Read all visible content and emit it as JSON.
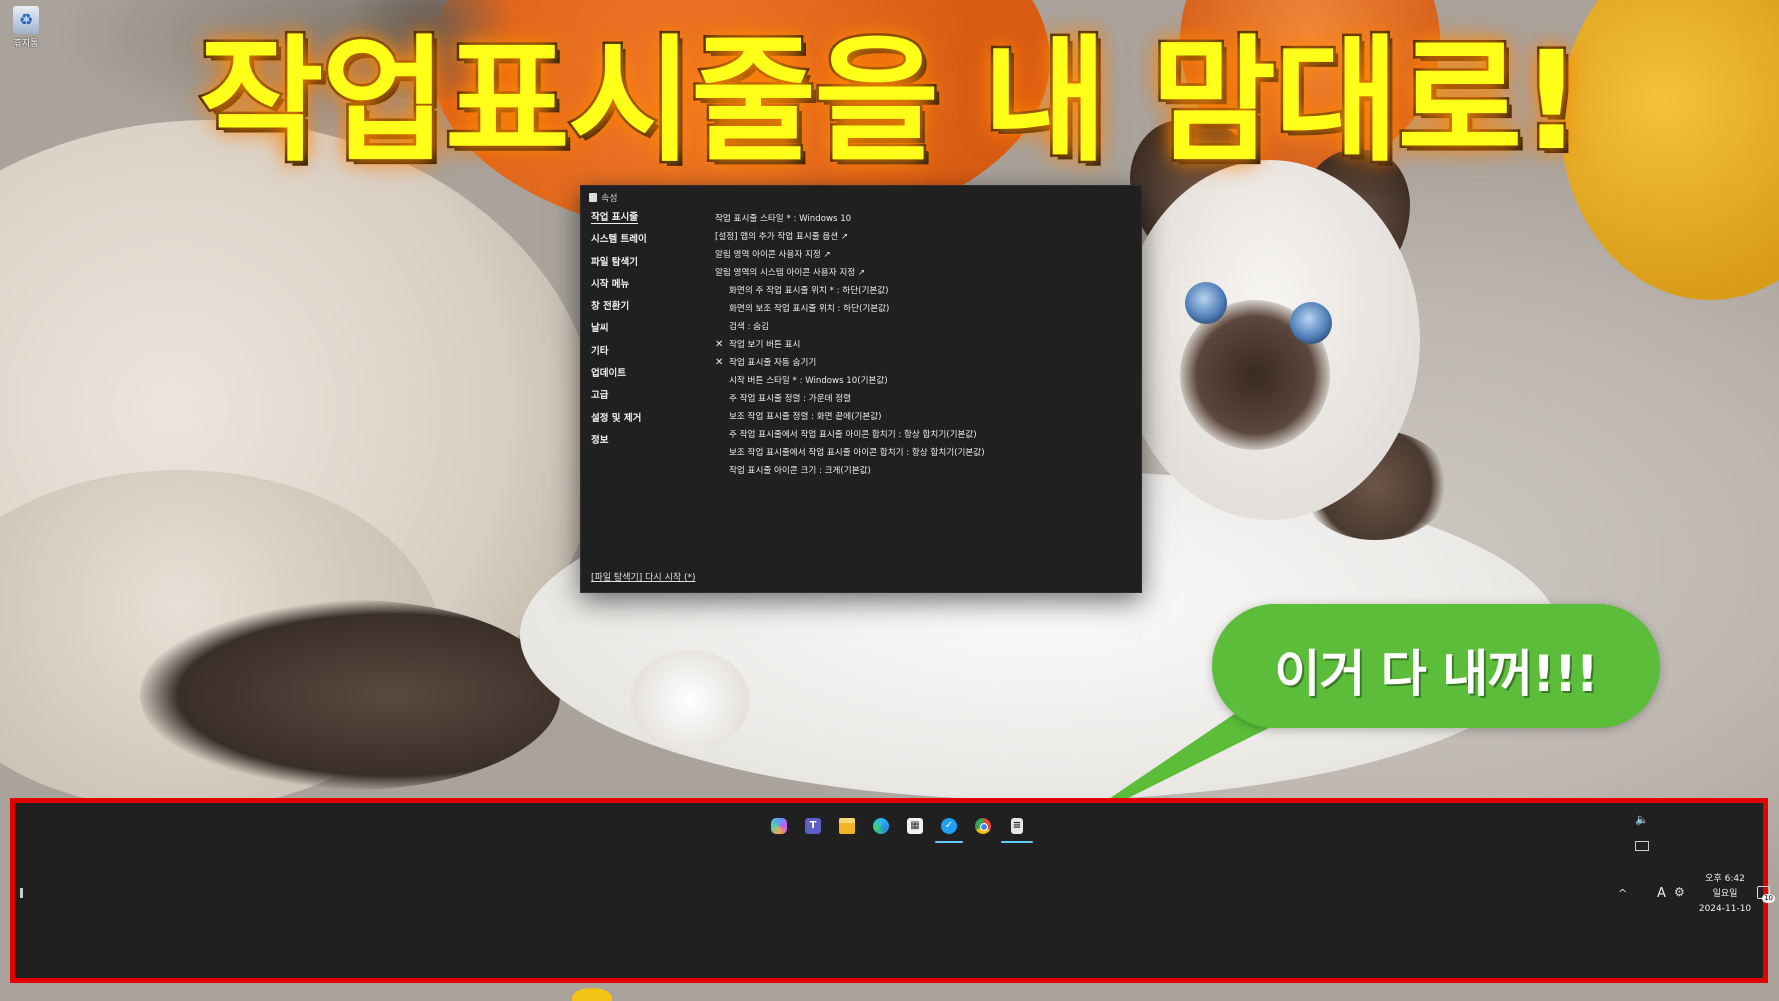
{
  "desktop": {
    "recycle_bin_label": "휴지통",
    "recycle_bin_icon": "recycle-bin-icon"
  },
  "headline": "작업표시줄을 내 맘대로!",
  "window": {
    "title": "속성",
    "nav": [
      {
        "label": "작업 표시줄",
        "active": true
      },
      {
        "label": "시스템 트레이"
      },
      {
        "label": "파일 탐색기"
      },
      {
        "label": "시작 메뉴"
      },
      {
        "label": "창 전환기"
      },
      {
        "label": "날씨"
      },
      {
        "label": "기타"
      },
      {
        "label": "업데이트"
      },
      {
        "label": "고급"
      },
      {
        "label": "설정 및 제거"
      },
      {
        "label": "정보"
      }
    ],
    "options": [
      {
        "label": "작업 표시줄 스타일 * : Windows 10",
        "indent": false,
        "checked": false
      },
      {
        "label": "[설정] 앱의 추가 작업 표시줄 옵션 ↗",
        "indent": false,
        "checked": false
      },
      {
        "label": "알림 영역 아이콘 사용자 지정 ↗",
        "indent": false,
        "checked": false
      },
      {
        "label": "알림 영역의 시스템 아이콘 사용자 지정 ↗",
        "indent": false,
        "checked": false
      },
      {
        "label": "화면의 주 작업 표시줄 위치 * : 하단(기본값)",
        "indent": true,
        "checked": false
      },
      {
        "label": "화면의 보조 작업 표시줄 위치 : 하단(기본값)",
        "indent": true,
        "checked": false
      },
      {
        "label": "검색 : 숨김",
        "indent": true,
        "checked": false
      },
      {
        "label": "작업 보기 버튼 표시",
        "indent": true,
        "checked": true
      },
      {
        "label": "작업 표시줄 자동 숨기기",
        "indent": true,
        "checked": true
      },
      {
        "label": "시작 버튼 스타일 * : Windows 10(기본값)",
        "indent": true,
        "checked": false
      },
      {
        "label": "주 작업 표시줄 정렬 : 가운데 정렬",
        "indent": true,
        "checked": false
      },
      {
        "label": "보조 작업 표시줄 정렬 : 화면 끝에(기본값)",
        "indent": true,
        "checked": false
      },
      {
        "label": "주 작업 표시줄에서 작업 표시줄 아이콘 합치기 : 항상 합치기(기본값)",
        "indent": true,
        "checked": false
      },
      {
        "label": "보조 작업 표시줄에서 작업 표시줄 아이콘 합치기 : 항상 합치기(기본값)",
        "indent": true,
        "checked": false
      },
      {
        "label": "작업 표시줄 아이콘 크기 : 크게(기본값)",
        "indent": true,
        "checked": false
      }
    ],
    "check_mark": "✕",
    "restart_link": "[파일 탐색기] 다시 시작 (*)"
  },
  "bubble": {
    "text": "이거 다 내꺼!!!",
    "color": "#5bbd3a"
  },
  "taskbar": {
    "border_color": "#e00000",
    "apps": [
      {
        "name": "copilot-icon",
        "glyph": "",
        "cls": "copilot",
        "running": false
      },
      {
        "name": "teams-icon",
        "glyph": "T",
        "cls": "teams",
        "running": false
      },
      {
        "name": "file-explorer-icon",
        "glyph": "",
        "cls": "folder",
        "running": false
      },
      {
        "name": "edge-icon",
        "glyph": "",
        "cls": "edge",
        "running": false
      },
      {
        "name": "store-icon",
        "glyph": "▦",
        "cls": "store",
        "running": false
      },
      {
        "name": "twitter-icon",
        "glyph": "✓",
        "cls": "twitter",
        "running": true
      },
      {
        "name": "chrome-icon",
        "glyph": "",
        "cls": "chrome",
        "running": false
      },
      {
        "name": "properties-app-icon",
        "glyph": "≡",
        "cls": "props",
        "running": true
      }
    ],
    "tray": {
      "volume_icon": "🔈",
      "chevron": "^",
      "ime": "A",
      "gear_icon": "⚙",
      "time": "오후 6:42",
      "day": "일요일",
      "date": "2024-11-10",
      "notification_count": "10"
    }
  }
}
